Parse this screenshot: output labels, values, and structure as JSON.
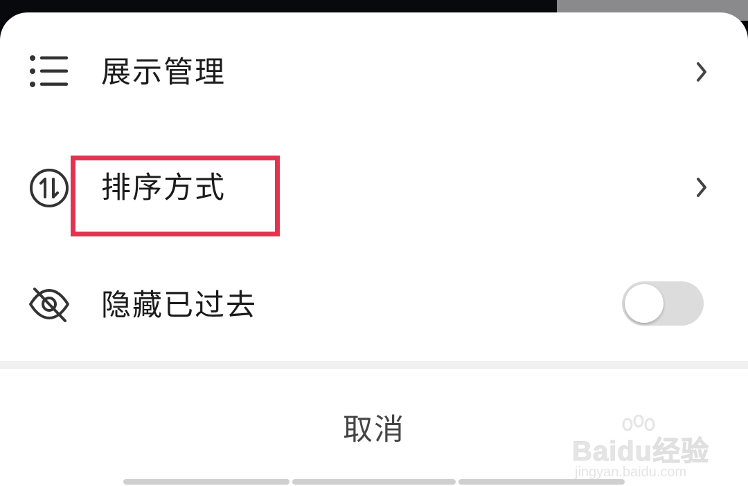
{
  "menu": {
    "items": [
      {
        "label": "展示管理",
        "icon": "list-icon",
        "has_chevron": true
      },
      {
        "label": "排序方式",
        "icon": "sort-icon",
        "has_chevron": true
      },
      {
        "label": "隐藏已过去",
        "icon": "eye-off-icon",
        "toggle": "off"
      }
    ]
  },
  "cancel": {
    "label": "取消"
  },
  "watermark": {
    "brand": "Baidu经验",
    "url": "jingyan.baidu.com"
  },
  "colors": {
    "highlight": "#e3334e",
    "toggle_off": "#dcdcdc",
    "text": "#1b1b1b"
  }
}
